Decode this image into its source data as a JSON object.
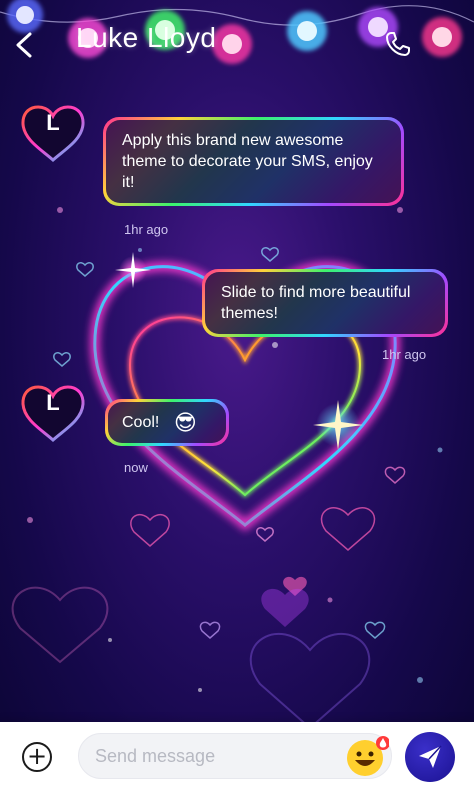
{
  "header": {
    "contact_name": "Luke Lloyd",
    "back_icon": "back-arrow-icon",
    "call_icon": "phone-icon"
  },
  "messages": [
    {
      "sender": "incoming",
      "avatar_letter": "L",
      "text": "Apply this brand new awesome theme to decorate your SMS, enjoy it!",
      "time": "1hr ago"
    },
    {
      "sender": "outgoing",
      "text": "Slide to find more beautiful themes!",
      "time": "1hr ago"
    },
    {
      "sender": "incoming",
      "avatar_letter": "L",
      "text": "Cool!",
      "emoji": "😎",
      "time": "now"
    }
  ],
  "compose": {
    "placeholder": "Send message",
    "add_icon": "plus-circle-icon",
    "emoji_icon": "emoji-face-icon",
    "send_icon": "send-arrow-icon"
  },
  "colors": {
    "accent": "#2a1fb0",
    "bubble_fill": "#1c0c46",
    "neon_pink": "#ff2f92",
    "neon_blue": "#31d7ff"
  }
}
